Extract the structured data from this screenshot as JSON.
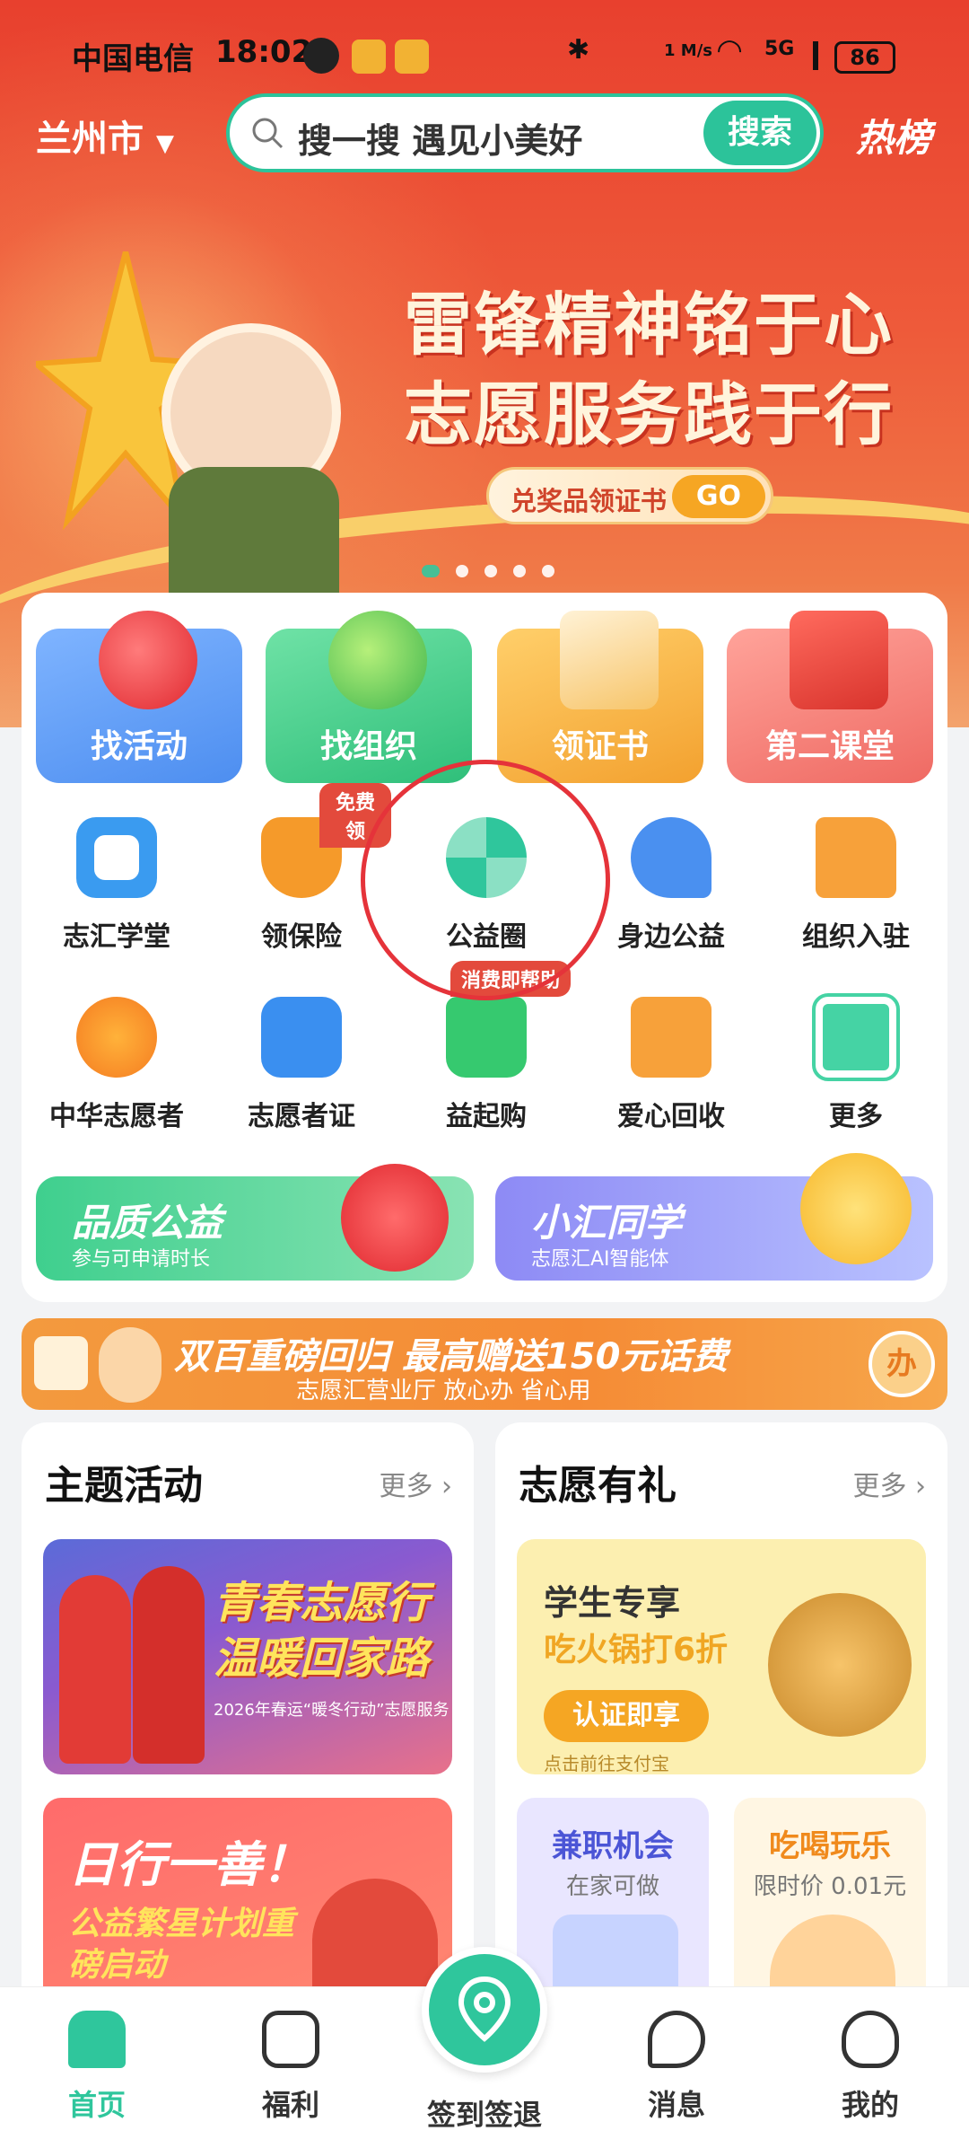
{
  "status_bar": {
    "carrier": "中国电信",
    "time": "18:02",
    "speed": "1 M/s",
    "network": "5G",
    "battery": "86"
  },
  "header": {
    "city": "兰州市",
    "search_placeholder": "搜一搜 遇见小美好",
    "search_button": "搜索",
    "hot_list": "热榜"
  },
  "banner": {
    "line1": "雷锋精神铭于心",
    "line2": "志愿服务践于行",
    "cta": "兑奖品领证书",
    "go": "GO"
  },
  "big_tiles": [
    {
      "label": "找活动",
      "icon": "heart-icon",
      "color": "#5b9bf2"
    },
    {
      "label": "找组织",
      "icon": "megaphone-icon",
      "color": "#34c986"
    },
    {
      "label": "领证书",
      "icon": "certificate-icon",
      "color": "#f3b03e"
    },
    {
      "label": "第二课堂",
      "icon": "book-icon",
      "color": "#f27a74"
    }
  ],
  "grid_row1": [
    {
      "label": "志汇学堂",
      "icon": "play-icon"
    },
    {
      "label": "领保险",
      "icon": "shield-icon",
      "badge": "免费领"
    },
    {
      "label": "公益圈",
      "icon": "pinwheel-icon"
    },
    {
      "label": "身边公益",
      "icon": "location-heart-icon"
    },
    {
      "label": "组织入驻",
      "icon": "flag-icon"
    }
  ],
  "grid_row2": [
    {
      "label": "中华志愿者",
      "icon": "bird-logo-icon"
    },
    {
      "label": "志愿者证",
      "icon": "id-card-icon"
    },
    {
      "label": "益起购",
      "icon": "shopping-bag-icon",
      "badge": "消费即帮助"
    },
    {
      "label": "爱心回收",
      "icon": "heart-box-icon"
    },
    {
      "label": "更多",
      "icon": "grid-icon"
    }
  ],
  "promos": [
    {
      "title": "品质公益",
      "subtitle": "参与可申请时长"
    },
    {
      "title": "小汇同学",
      "subtitle": "志愿汇AI智能体"
    }
  ],
  "ad_strip": {
    "headline": "双百重磅回归  最高赠送150元话费",
    "sub": "志愿汇营业厅  放心办  省心用",
    "button": "办"
  },
  "theme_section": {
    "title": "主题活动",
    "more": "更多",
    "card1_title": "青春志愿行温暖回家路",
    "card1_sub": "2026年春运“暖冬行动”志愿服务",
    "card2_title": "日行一善！",
    "card2_sub": "公益繁星计划重磅启动"
  },
  "gift_section": {
    "title": "志愿有礼",
    "more": "更多",
    "g1_title": "学生专享",
    "g1_sub": "吃火锅打6折",
    "g1_button": "认证即享",
    "g1_note": "点击前往支付宝",
    "g2_title": "兼职机会",
    "g2_sub": "在家可做",
    "g3_title": "吃喝玩乐",
    "g3_sub": "限时价 0.01元"
  },
  "bottom_nav": [
    {
      "label": "首页",
      "icon": "home-icon",
      "active": true
    },
    {
      "label": "福利",
      "icon": "heart-badge-icon"
    },
    {
      "label": "签到签退",
      "icon": "location-pin-icon"
    },
    {
      "label": "消息",
      "icon": "chat-icon"
    },
    {
      "label": "我的",
      "icon": "profile-icon"
    }
  ],
  "colors": {
    "brand": "#2fc69c",
    "hero_red": "#e8402e",
    "highlight": "#e5333a"
  }
}
